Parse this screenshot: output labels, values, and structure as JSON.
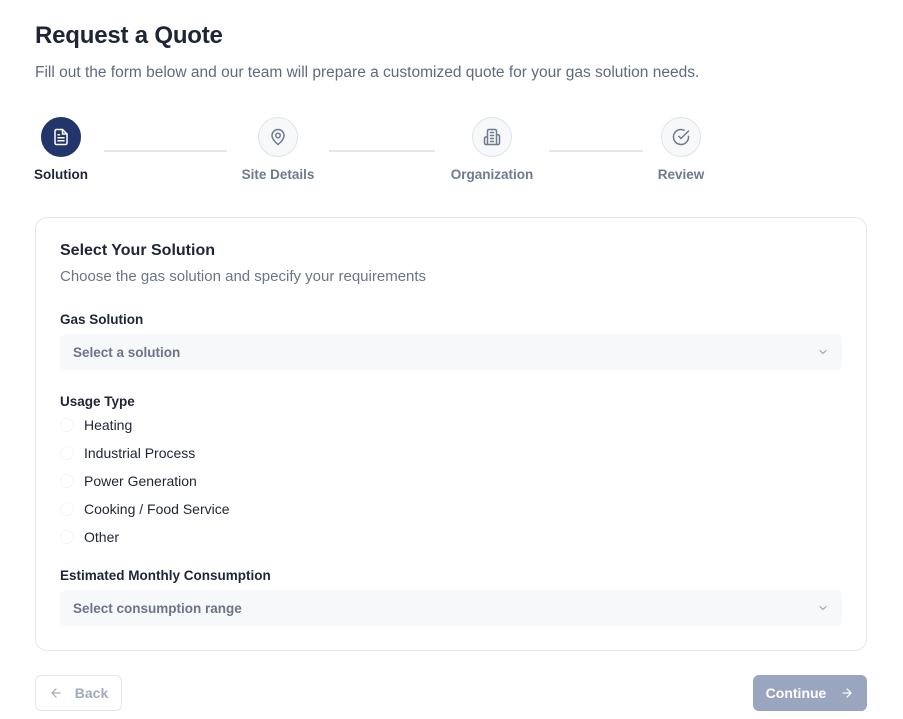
{
  "header": {
    "title": "Request a Quote",
    "subtitle": "Fill out the form below and our team will prepare a customized quote for your gas solution needs."
  },
  "stepper": {
    "steps": [
      {
        "label": "Solution",
        "icon": "document-icon",
        "active": true
      },
      {
        "label": "Site Details",
        "icon": "map-pin-icon",
        "active": false
      },
      {
        "label": "Organization",
        "icon": "building-icon",
        "active": false
      },
      {
        "label": "Review",
        "icon": "check-circle-icon",
        "active": false
      }
    ]
  },
  "form": {
    "title": "Select Your Solution",
    "description": "Choose the gas solution and specify your requirements",
    "gas_solution": {
      "label": "Gas Solution",
      "placeholder": "Select a solution"
    },
    "usage_type": {
      "label": "Usage Type",
      "options": [
        "Heating",
        "Industrial Process",
        "Power Generation",
        "Cooking / Food Service",
        "Other"
      ]
    },
    "consumption": {
      "label": "Estimated Monthly Consumption",
      "placeholder": "Select consumption range"
    }
  },
  "footer": {
    "back_label": "Back",
    "continue_label": "Continue"
  },
  "colors": {
    "primary": "#23366b",
    "continue_disabled": "#9aa5bf",
    "muted_text": "#6a7587"
  }
}
